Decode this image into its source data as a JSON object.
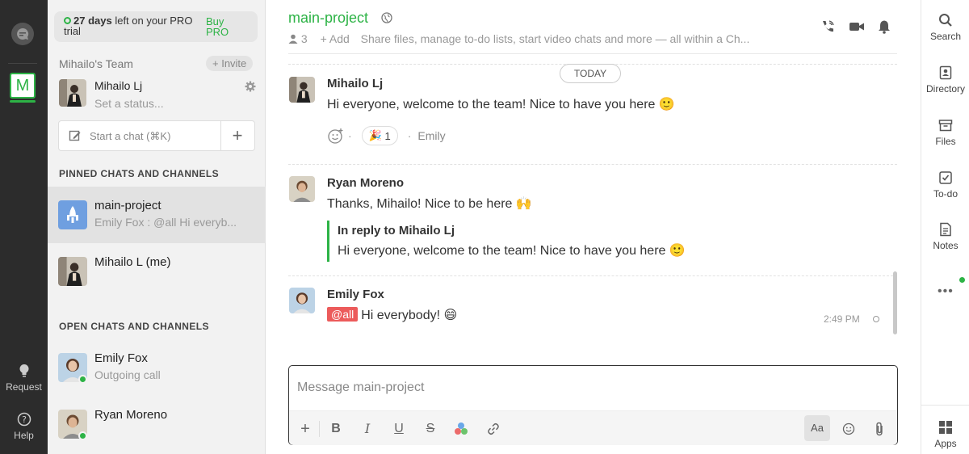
{
  "rail": {
    "team_initial": "M",
    "request_label": "Request",
    "help_label": "Help"
  },
  "sidebar": {
    "trial_days": "27 days",
    "trial_rest": "left on your PRO trial",
    "buy_pro": "Buy PRO",
    "team_name": "Mihailo's Team",
    "invite": "+ Invite",
    "user_name": "Mihailo Lj",
    "user_status_placeholder": "Set a status...",
    "start_chat_label": "Start a chat (⌘K)",
    "pinned_header": "PINNED CHATS AND CHANNELS",
    "open_header": "OPEN CHATS AND CHANNELS",
    "pinned": [
      {
        "name": "main-project",
        "sub": "Emily Fox : @all Hi everyb..."
      },
      {
        "name": "Mihailo L (me)",
        "sub": ""
      }
    ],
    "open": [
      {
        "name": "Emily Fox",
        "sub": "Outgoing call"
      },
      {
        "name": "Ryan Moreno",
        "sub": ""
      }
    ]
  },
  "channel": {
    "title": "main-project",
    "members": "3",
    "add": "+ Add",
    "description": "Share files, manage to-do lists, start video chats and more — all within a Ch..."
  },
  "messages": {
    "today": "TODAY",
    "m1": {
      "author": "Mihailo Lj",
      "text": "Hi everyone, welcome to the team! Nice to have you here 🙂",
      "reaction_emoji": "🎉",
      "reaction_count": "1",
      "reacted_by": "Emily"
    },
    "m2": {
      "author": "Ryan Moreno",
      "text": "Thanks, Mihailo! Nice to be here 🙌",
      "reply_header": "In reply to Mihailo Lj",
      "reply_text": "Hi everyone, welcome to the team! Nice to have you here 🙂"
    },
    "m3": {
      "author": "Emily Fox",
      "mention": "@all",
      "text": "Hi everybody! 😄",
      "time": "2:49 PM"
    }
  },
  "composer": {
    "placeholder": "Message main-project",
    "aa": "Aa"
  },
  "right_rail": {
    "search": "Search",
    "directory": "Directory",
    "files": "Files",
    "todo": "To-do",
    "notes": "Notes",
    "more": "•••",
    "apps": "Apps"
  },
  "colors": {
    "accent": "#2db346",
    "mention": "#ec5b5b",
    "rail": "#2c2c2c"
  }
}
